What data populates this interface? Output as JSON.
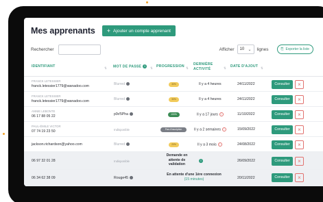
{
  "page": {
    "title": "Mes apprenants",
    "add_button": "Ajouter un compte apprenant",
    "search_label": "Rechercher",
    "search_value": "",
    "show_label": "Afficher",
    "page_size": "10",
    "lines_label": "lignes",
    "export_label": "Exporter la liste"
  },
  "columns": {
    "identifiant": "IDENTIFIANT",
    "password": "MOT DE PASSE",
    "progression": "PROGRESSION",
    "activity_1": "DERNIÈRE",
    "activity_2": "ACTIVITÉ",
    "date": "DATE D'AJOUT"
  },
  "rows": [
    {
      "name": "FRANCK LETESSIER",
      "id": "franck.letessier1779@wanadoo.com",
      "password": "Blurred",
      "progress": "30%",
      "activity": "Il y a 4 heures",
      "date": "24/11/2022",
      "action": "Consulter"
    },
    {
      "name": "FRANCK LETESSIER",
      "id": "franck.letessier1779@wanadoo.com",
      "password": "Blurred",
      "progress": "30%",
      "activity": "Il y a 4 heures",
      "date": "24/11/2022",
      "action": "Consulter"
    },
    {
      "name": "ANNIE LEBONTE",
      "id": "06 17 88 05 22",
      "password": "p9r/5Pha",
      "progress": "100%",
      "activity": "Il y a 17 jours",
      "date": "11/10/2022",
      "action": "Consulter"
    },
    {
      "name": "PAUL-ÉMILE VICTOR",
      "id": "07 74 19 23 50",
      "password": "Indisponible",
      "progress": "Pas d'inscription",
      "activity": "Il y a 2 semaines",
      "date": "15/09/2022",
      "action": "Consulter"
    },
    {
      "name": "",
      "id": "jackson.richardson@yahoo.com",
      "password": "Blurred",
      "progress": "20%",
      "activity": "Il y a 3 mois",
      "date": "24/08/2022",
      "action": "Consulter"
    },
    {
      "name": "",
      "id": "06 97 32 01 28",
      "password": "Indisponible",
      "activity_1": "Demande en",
      "activity_2": "attente de",
      "activity_3": "validation",
      "date": "26/09/2022",
      "action": "Consulter"
    },
    {
      "name": "",
      "id": "06 34 62 38 09",
      "password": "Rouge45",
      "activity_1": "En attente d'une 1ère connexion",
      "activity_2": "(15 minutes)",
      "date": "20/11/2022",
      "action": "Consulter"
    }
  ],
  "colors": {
    "accent": "#2e9a7c",
    "danger": "#e2726f"
  }
}
